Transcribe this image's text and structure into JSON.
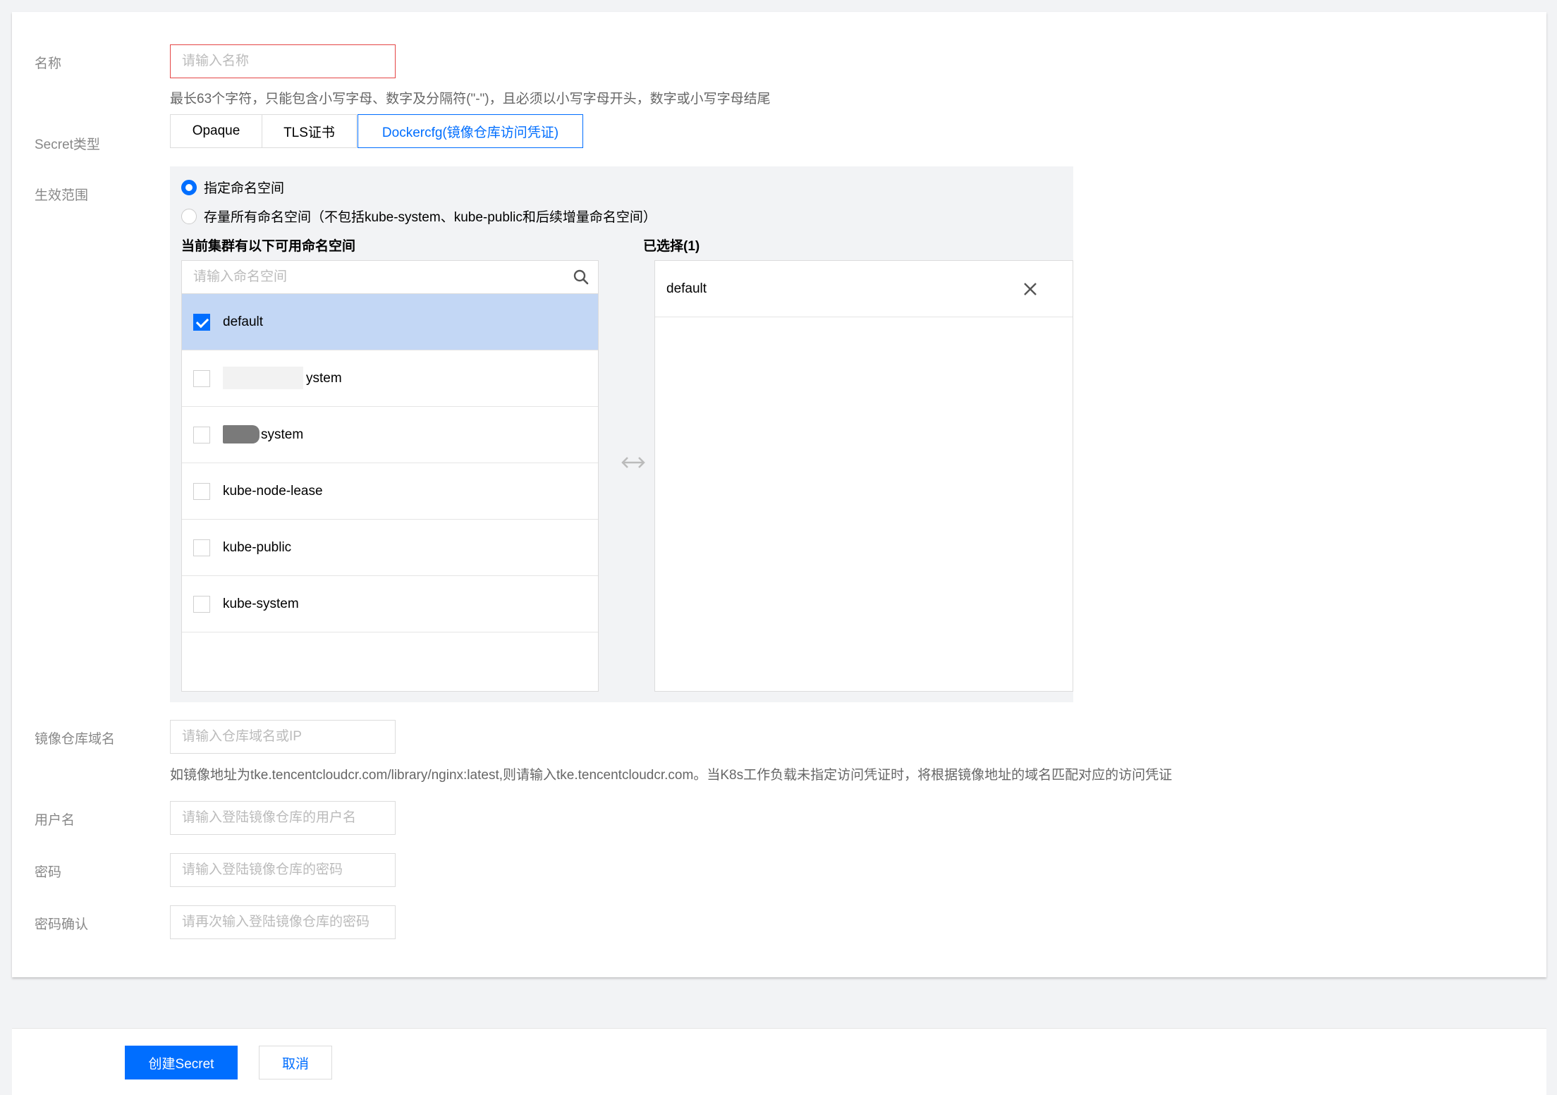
{
  "form": {
    "name": {
      "label": "名称",
      "placeholder": "请输入名称",
      "value": "",
      "help": "最长63个字符，只能包含小写字母、数字及分隔符(\"-\")，且必须以小写字母开头，数字或小写字母结尾"
    },
    "secret_type": {
      "label": "Secret类型",
      "options": [
        "Opaque",
        "TLS证书",
        "Dockercfg(镜像仓库访问凭证)"
      ],
      "selected": "Dockercfg(镜像仓库访问凭证)"
    },
    "scope": {
      "label": "生效范围",
      "radios": [
        "指定命名空间",
        "存量所有命名空间（不包括kube-system、kube-public和后续增量命名空间）"
      ],
      "selected_radio": "指定命名空间",
      "available_title": "当前集群有以下可用命名空间",
      "search_placeholder": "请输入命名空间",
      "namespaces": [
        {
          "name": "default",
          "checked": true
        },
        {
          "name": "ystem",
          "checked": false
        },
        {
          "name": "system",
          "checked": false
        },
        {
          "name": "kube-node-lease",
          "checked": false
        },
        {
          "name": "kube-public",
          "checked": false
        },
        {
          "name": "kube-system",
          "checked": false
        }
      ],
      "selected_title": "已选择(1)",
      "selected_items": [
        "default"
      ],
      "transfer_icon": "left-right-arrow-icon"
    },
    "registry": {
      "label": "镜像仓库域名",
      "placeholder": "请输入仓库域名或IP",
      "value": "",
      "help": "如镜像地址为tke.tencentcloudcr.com/library/nginx:latest,则请输入tke.tencentcloudcr.com。当K8s工作负载未指定访问凭证时，将根据镜像地址的域名匹配对应的访问凭证"
    },
    "username": {
      "label": "用户名",
      "placeholder": "请输入登陆镜像仓库的用户名",
      "value": ""
    },
    "password": {
      "label": "密码",
      "placeholder": "请输入登陆镜像仓库的密码",
      "value": ""
    },
    "password_confirm": {
      "label": "密码确认",
      "placeholder": "请再次输入登陆镜像仓库的密码",
      "value": ""
    }
  },
  "footer": {
    "create_label": "创建Secret",
    "cancel_label": "取消"
  },
  "colors": {
    "primary": "#006eff",
    "error": "#e54545",
    "selected_row": "#c3d7f5"
  }
}
